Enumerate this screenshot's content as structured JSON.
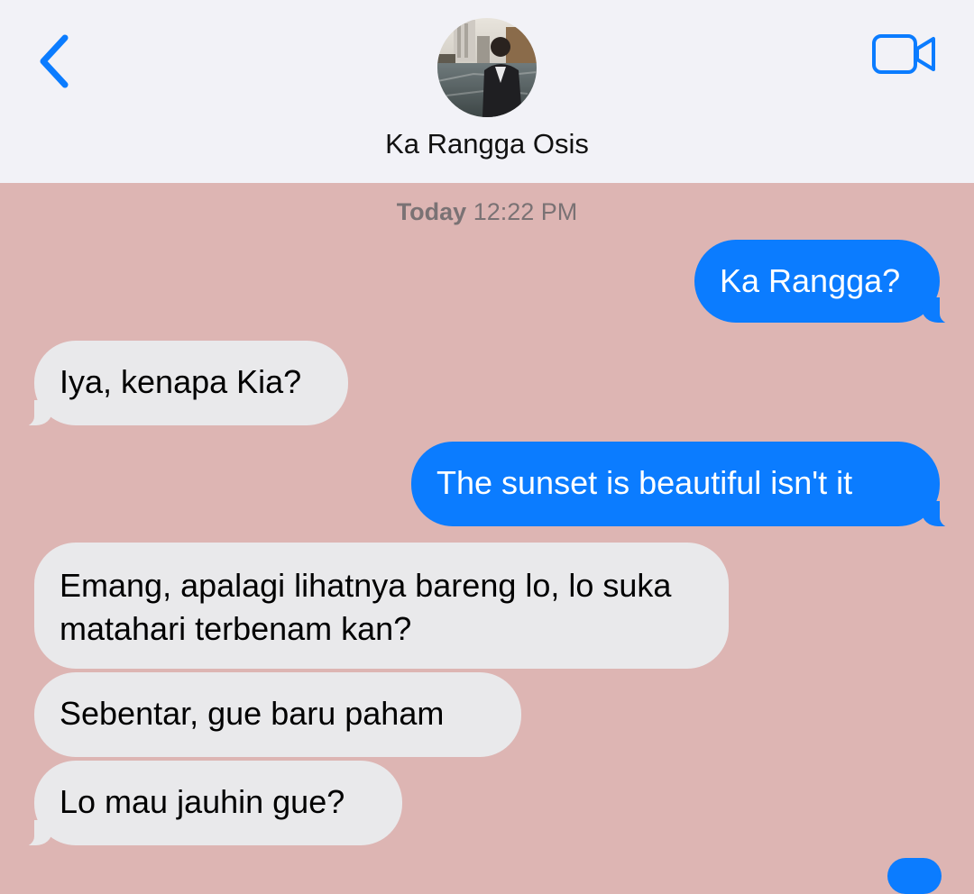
{
  "header": {
    "contact_name": "Ka Rangga Osis",
    "back_icon": "chevron-left-icon",
    "video_icon": "video-camera-icon",
    "accent_color": "#0b7cff"
  },
  "chat": {
    "timestamp_day": "Today",
    "timestamp_time": "12:22 PM",
    "background_color": "#ddb5b3",
    "messages": [
      {
        "direction": "outgoing",
        "text": "Ka Rangga?"
      },
      {
        "direction": "incoming",
        "text": "Iya, kenapa Kia?"
      },
      {
        "direction": "outgoing",
        "text": "The sunset is beautiful isn't it"
      },
      {
        "direction": "incoming",
        "text": "Emang, apalagi lihatnya bareng lo, lo suka matahari terbenam kan?"
      },
      {
        "direction": "incoming",
        "text": "Sebentar, gue baru paham"
      },
      {
        "direction": "incoming",
        "text": "Lo mau jauhin gue?"
      }
    ]
  }
}
